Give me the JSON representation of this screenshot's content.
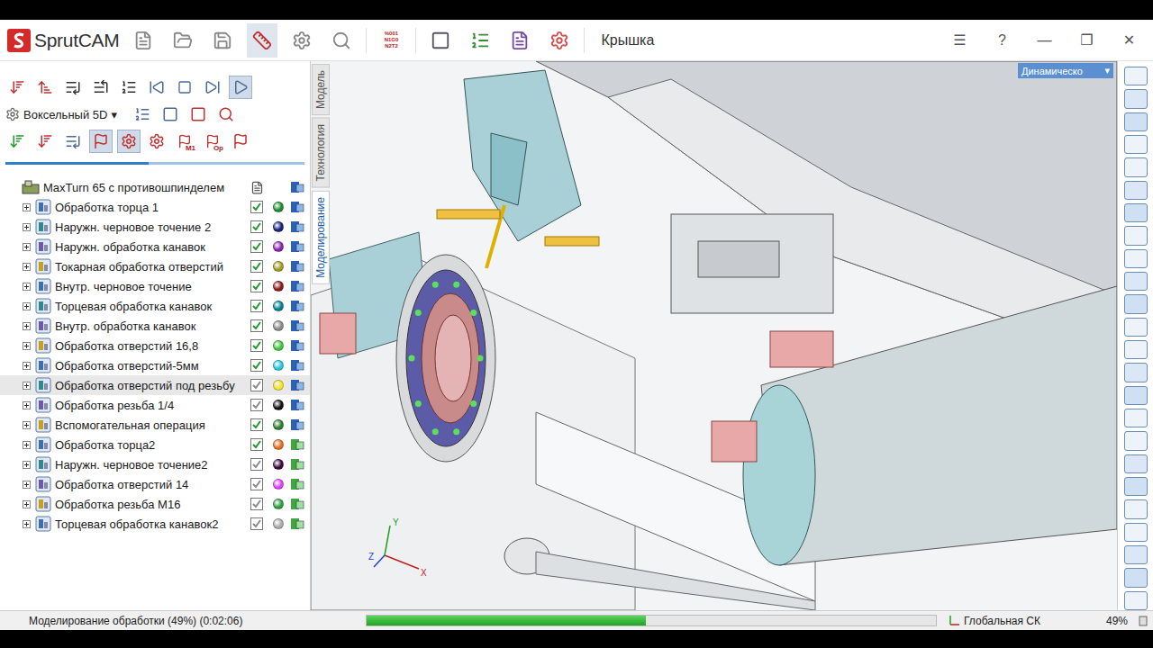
{
  "window": {
    "logo": "SprutCAM",
    "title": "Крышка",
    "gcode": [
      "%001",
      "N1G0",
      "N2T2"
    ],
    "controls": [
      "☰",
      "?",
      "—",
      "❐",
      "✕"
    ]
  },
  "toolbar": {
    "mode": "Воксельный 5D",
    "modeArrow": "▾",
    "labels": [
      "M1",
      "Op"
    ],
    "playing": true,
    "pressed": [
      true,
      true
    ]
  },
  "slider": {
    "level": 0.48
  },
  "tree": {
    "root": "MaxTurn 65 с противошпинделем",
    "items": [
      {
        "label": "Обработка торца 1",
        "checked": true,
        "simulated": false,
        "selected": false,
        "color": "#1e8c2e"
      },
      {
        "label": "Наружн. черновое точение 2",
        "checked": true,
        "simulated": false,
        "selected": false,
        "color": "#1a237e"
      },
      {
        "label": "Наружн. обработка канавок",
        "checked": true,
        "simulated": false,
        "selected": false,
        "color": "#8e24aa"
      },
      {
        "label": "Токарная обработка отверстий",
        "checked": true,
        "simulated": false,
        "selected": false,
        "color": "#9e9d24"
      },
      {
        "label": "Внутр. черновое точение",
        "checked": true,
        "simulated": false,
        "selected": false,
        "color": "#8b1a1a"
      },
      {
        "label": "Торцевая обработка канавок",
        "checked": true,
        "simulated": false,
        "selected": false,
        "color": "#00838f"
      },
      {
        "label": "Внутр. обработка канавок",
        "checked": true,
        "simulated": false,
        "selected": false,
        "color": "#8a8a8a"
      },
      {
        "label": "Обработка отверстий 16,8",
        "checked": true,
        "simulated": false,
        "selected": false,
        "color": "#43c443"
      },
      {
        "label": "Обработка отверстий-5мм",
        "checked": true,
        "simulated": false,
        "selected": false,
        "color": "#26c6da"
      },
      {
        "label": "Обработка отверстий под резьбу",
        "checked": false,
        "simulated": false,
        "selected": true,
        "color": "#f2e52a"
      },
      {
        "label": "Обработка резьба 1/4",
        "checked": false,
        "simulated": false,
        "selected": false,
        "color": "#111111"
      },
      {
        "label": "Вспомогательная операция",
        "checked": true,
        "simulated": false,
        "selected": false,
        "color": "#2e7d32"
      },
      {
        "label": "Обработка торца2",
        "checked": true,
        "simulated": true,
        "selected": false,
        "color": "#e07020"
      },
      {
        "label": "Наружн. черновое точение2",
        "checked": false,
        "simulated": true,
        "selected": false,
        "color": "#3a0a3a"
      },
      {
        "label": "Обработка отверстий 14",
        "checked": false,
        "simulated": true,
        "selected": false,
        "color": "#e040fb"
      },
      {
        "label": "Обработка резьба М16",
        "checked": false,
        "simulated": true,
        "selected": false,
        "color": "#2e9e3e"
      },
      {
        "label": "Торцевая обработка канавок2",
        "checked": false,
        "simulated": true,
        "selected": false,
        "color": "#aaaaaa"
      }
    ]
  },
  "viewTabs": [
    {
      "label": "Модель",
      "selected": false
    },
    {
      "label": "Технология",
      "selected": false
    },
    {
      "label": "Моделирование",
      "selected": true
    }
  ],
  "viewMode": {
    "label": "Динамическо",
    "arrow": "▾"
  },
  "axes": {
    "x": "X",
    "y": "Y",
    "z": "Z"
  },
  "status": {
    "text": "Моделирование обработки (49%) (0:02:06)",
    "level": 0.49,
    "cs": "Глобальная СК",
    "zoom": "49%"
  }
}
